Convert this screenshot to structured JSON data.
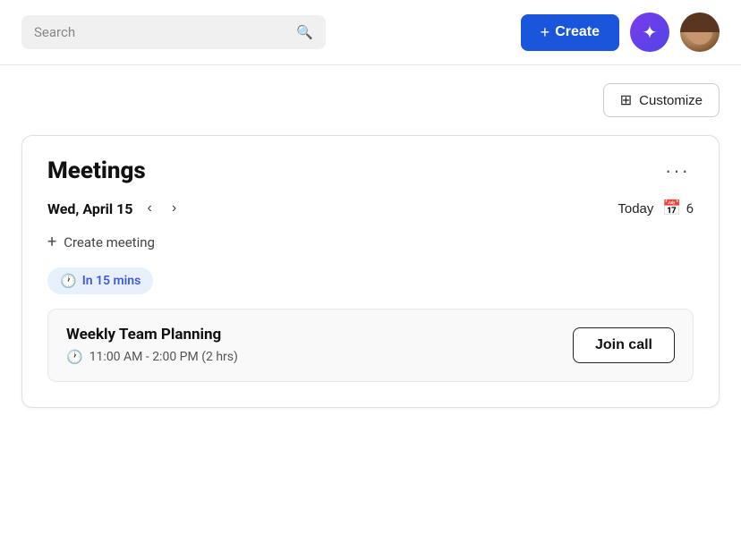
{
  "header": {
    "search_placeholder": "Search",
    "create_label": "Create",
    "ai_btn_label": "✦",
    "avatar_alt": "User avatar"
  },
  "customize": {
    "button_label": "Customize",
    "grid_icon": "⊞"
  },
  "meetings": {
    "title": "Meetings",
    "more_icon": "···",
    "date_label": "Wed, April 15",
    "prev_arrow": "‹",
    "next_arrow": "›",
    "today_label": "Today",
    "calendar_count": "6",
    "create_meeting_label": "Create meeting",
    "time_badge": "In 15 mins",
    "meeting_name": "Weekly Team Planning",
    "meeting_time": "11:00 AM - 2:00 PM (2 hrs)",
    "join_call_label": "Join call"
  }
}
